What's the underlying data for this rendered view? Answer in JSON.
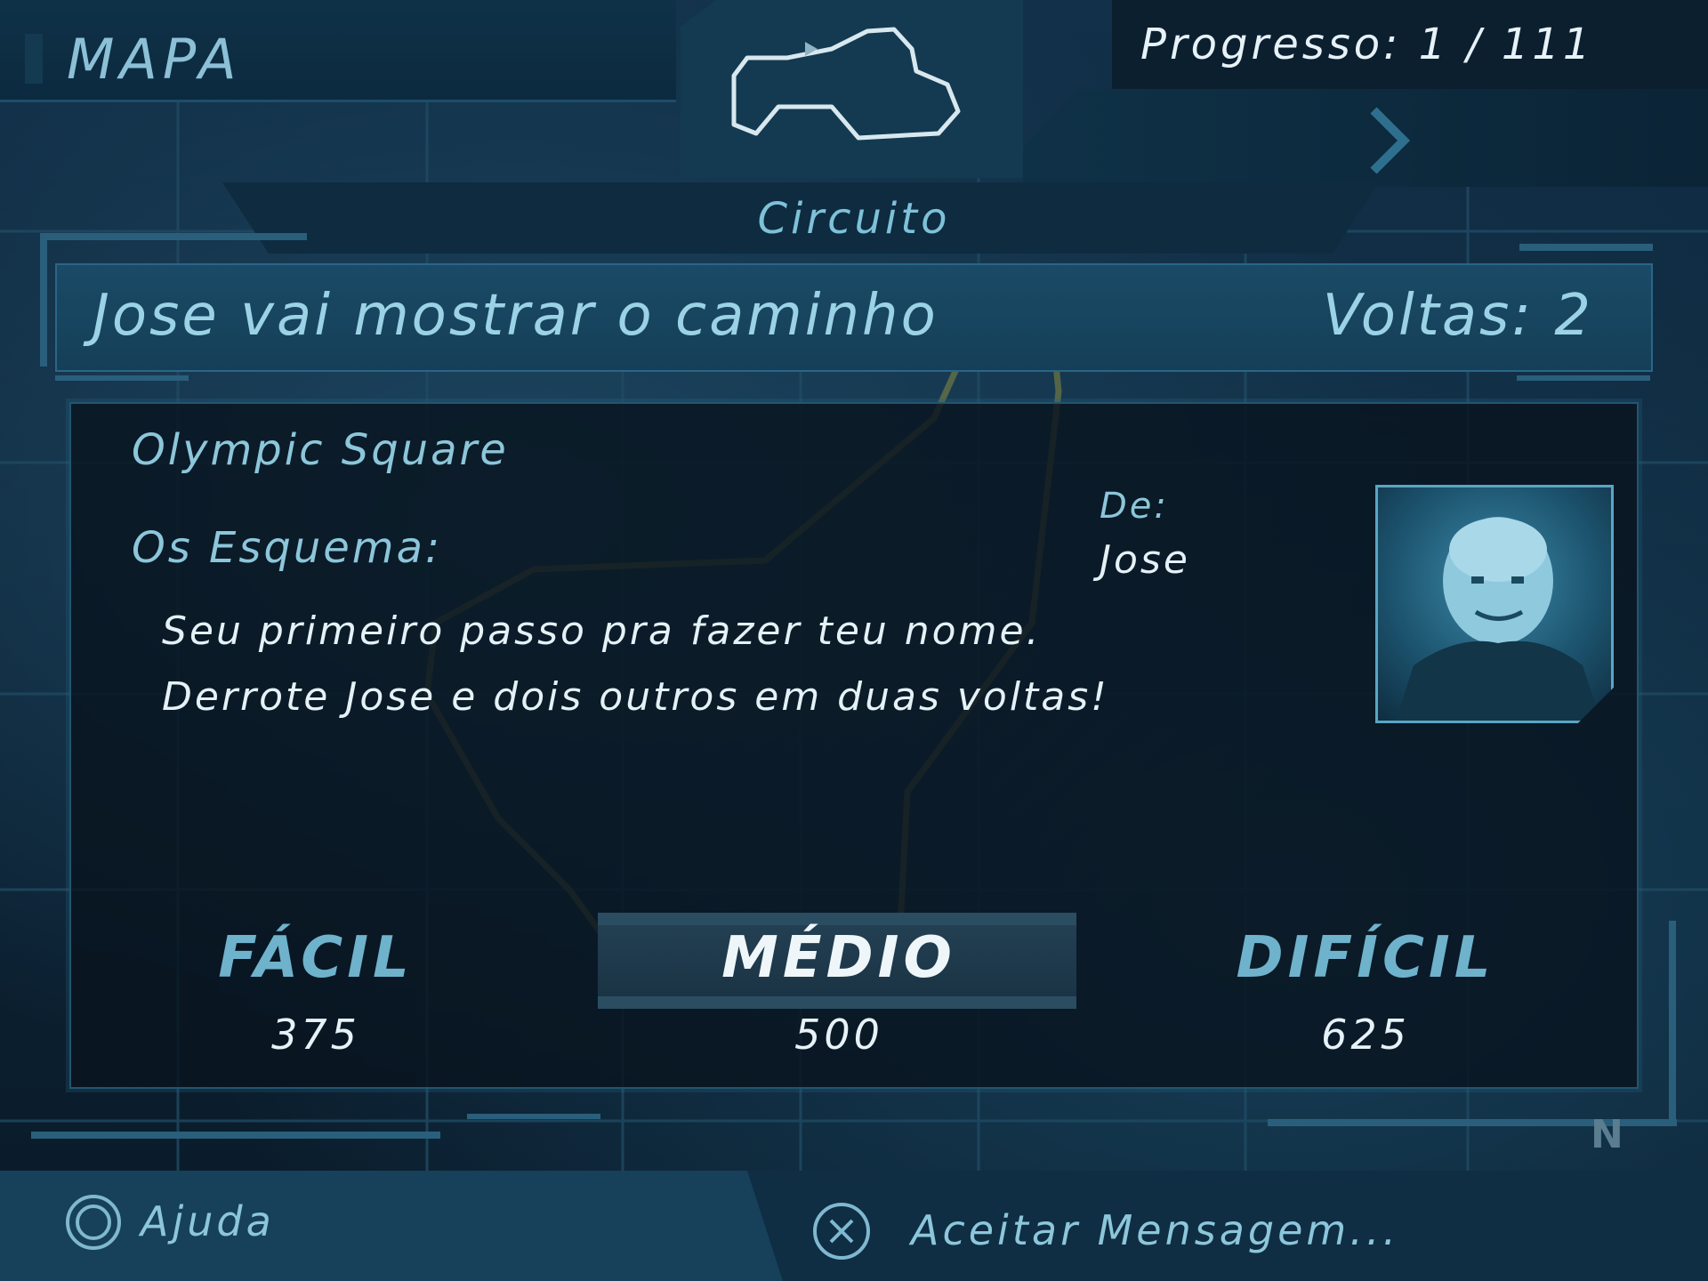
{
  "screen": {
    "title": "MAPA",
    "progress": "Progresso: 1 / 111",
    "race_type": "Circuito"
  },
  "event": {
    "title": "Jose vai mostrar o caminho",
    "laps": "Voltas: 2",
    "location": "Olympic Square",
    "section_label": "Os Esquema:",
    "description_line1": "Seu primeiro passo pra fazer teu nome.",
    "description_line2": "Derrote Jose e dois outros em duas voltas!",
    "from_label": "De:",
    "from_name": "Jose"
  },
  "difficulty": {
    "selected": "MÉDIO",
    "options": [
      {
        "label": "FÁCIL",
        "value": "375"
      },
      {
        "label": "MÉDIO",
        "value": "500"
      },
      {
        "label": "DIFÍCIL",
        "value": "625"
      }
    ]
  },
  "controls": {
    "help_label": "Ajuda",
    "accept_label": "Aceitar Mensagem..."
  },
  "compass": "N",
  "icons": {
    "help": "circle-button-icon",
    "accept": "cross-button-icon",
    "next": "chevron-right-icon",
    "track": "track-outline-icon",
    "portrait": "contact-portrait"
  },
  "colors": {
    "accent": "#9bd2e6",
    "panel": "#153f58",
    "highlight_text": "#eef6fa"
  }
}
